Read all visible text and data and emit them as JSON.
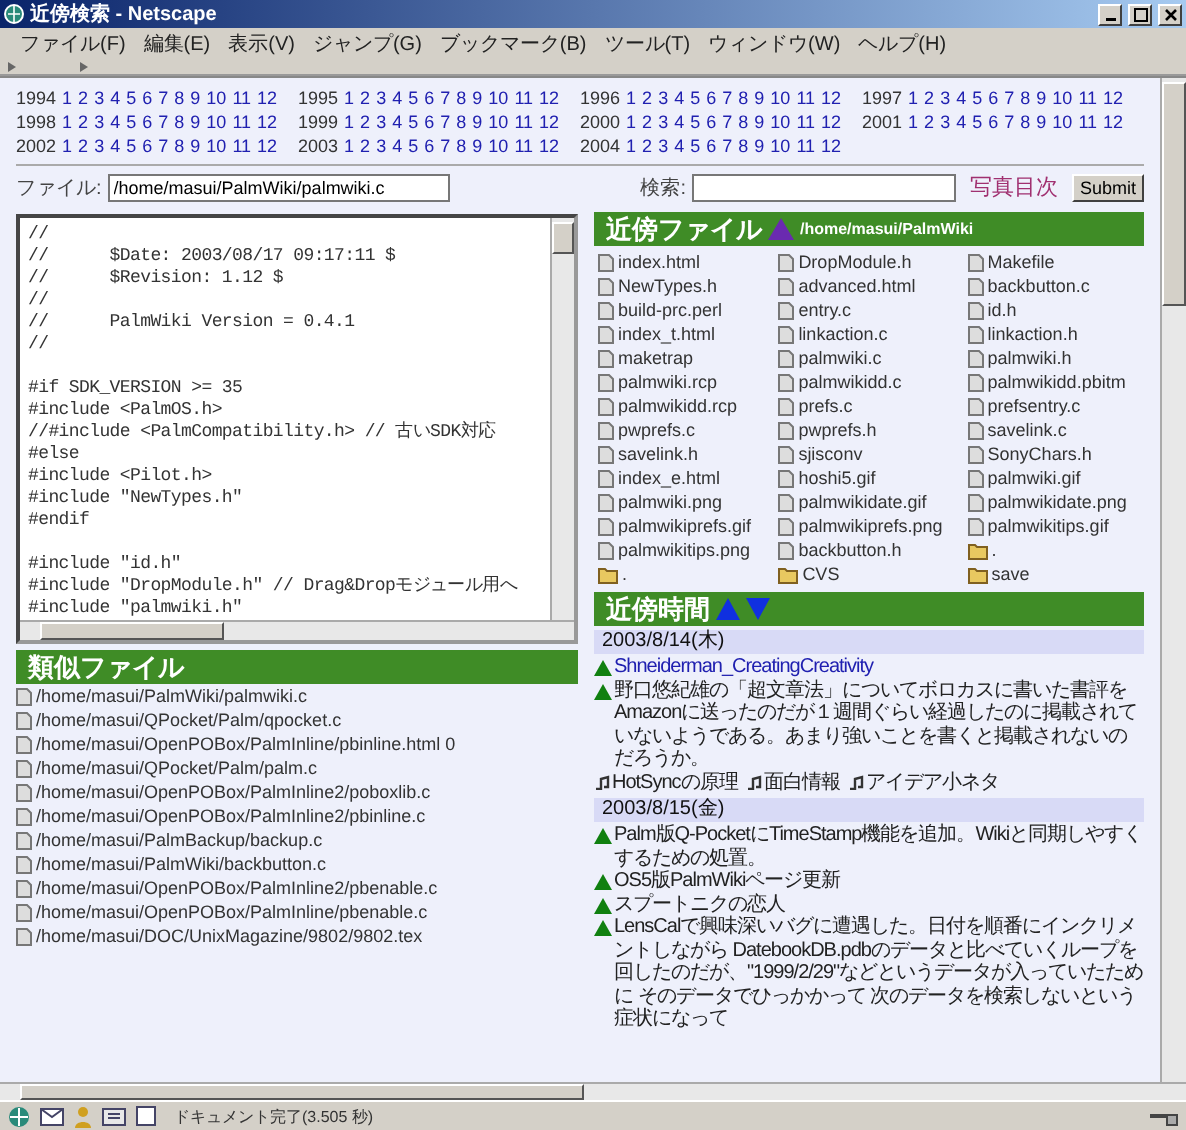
{
  "window": {
    "title": "近傍検索 - Netscape"
  },
  "menu": [
    "ファイル(F)",
    "編集(E)",
    "表示(V)",
    "ジャンプ(G)",
    "ブックマーク(B)",
    "ツール(T)",
    "ウィンドウ(W)",
    "ヘルプ(H)"
  ],
  "years": [
    {
      "year": "1994",
      "months": [
        "1",
        "2",
        "3",
        "4",
        "5",
        "6",
        "7",
        "8",
        "9",
        "10",
        "11",
        "12"
      ]
    },
    {
      "year": "1995",
      "months": [
        "1",
        "2",
        "3",
        "4",
        "5",
        "6",
        "7",
        "8",
        "9",
        "10",
        "11",
        "12"
      ]
    },
    {
      "year": "1996",
      "months": [
        "1",
        "2",
        "3",
        "4",
        "5",
        "6",
        "7",
        "8",
        "9",
        "10",
        "11",
        "12"
      ]
    },
    {
      "year": "1997",
      "months": [
        "1",
        "2",
        "3",
        "4",
        "5",
        "6",
        "7",
        "8",
        "9",
        "10",
        "11",
        "12"
      ]
    },
    {
      "year": "1998",
      "months": [
        "1",
        "2",
        "3",
        "4",
        "5",
        "6",
        "7",
        "8",
        "9",
        "10",
        "11",
        "12"
      ]
    },
    {
      "year": "1999",
      "months": [
        "1",
        "2",
        "3",
        "4",
        "5",
        "6",
        "7",
        "8",
        "9",
        "10",
        "11",
        "12"
      ]
    },
    {
      "year": "2000",
      "months": [
        "1",
        "2",
        "3",
        "4",
        "5",
        "6",
        "7",
        "8",
        "9",
        "10",
        "11",
        "12"
      ]
    },
    {
      "year": "2001",
      "months": [
        "1",
        "2",
        "3",
        "4",
        "5",
        "6",
        "7",
        "8",
        "9",
        "10",
        "11",
        "12"
      ]
    },
    {
      "year": "2002",
      "months": [
        "1",
        "2",
        "3",
        "4",
        "5",
        "6",
        "7",
        "8",
        "9",
        "10",
        "11",
        "12"
      ]
    },
    {
      "year": "2003",
      "months": [
        "1",
        "2",
        "3",
        "4",
        "5",
        "6",
        "7",
        "8",
        "9",
        "10",
        "11",
        "12"
      ]
    },
    {
      "year": "2004",
      "months": [
        "1",
        "2",
        "3",
        "4",
        "5",
        "6",
        "7",
        "8",
        "9",
        "10",
        "11",
        "12"
      ]
    }
  ],
  "file_field": {
    "label": "ファイル:",
    "value": "/home/masui/PalmWiki/palmwiki.c"
  },
  "search": {
    "label": "検索:",
    "photo_link": "写真目次",
    "submit": "Submit"
  },
  "code_blocks": [
    [
      "//",
      "//      $Date: 2003/08/17 09:17:11 $",
      "//      $Revision: 1.12 $",
      "//",
      "//      PalmWiki Version = 0.4.1",
      "//"
    ],
    [
      "#if SDK_VERSION >= 35",
      "#include <PalmOS.h>",
      "//#include <PalmCompatibility.h> // 古いSDK対応",
      "#else",
      "#include <Pilot.h>",
      "#include \"NewTypes.h\"",
      "#endif"
    ],
    [
      "#include \"id.h\"",
      "#include \"DropModule.h\" // Drag&Dropモジュール用へ",
      "#include \"palmwiki.h\""
    ]
  ],
  "similar": {
    "title": "類似ファイル",
    "paths": [
      "/home/masui/PalmWiki/palmwiki.c",
      "/home/masui/QPocket/Palm/qpocket.c",
      "/home/masui/OpenPOBox/PalmInline/pbinline.html 0",
      "/home/masui/QPocket/Palm/palm.c",
      "/home/masui/OpenPOBox/PalmInline2/poboxlib.c",
      "/home/masui/OpenPOBox/PalmInline2/pbinline.c",
      "/home/masui/PalmBackup/backup.c",
      "/home/masui/PalmWiki/backbutton.c",
      "/home/masui/OpenPOBox/PalmInline2/pbenable.c",
      "/home/masui/OpenPOBox/PalmInline/pbenable.c",
      "/home/masui/DOC/UnixMagazine/9802/9802.tex"
    ]
  },
  "nearby_files": {
    "title": "近傍ファイル",
    "path": "/home/masui/PalmWiki",
    "files": [
      {
        "name": "index.html",
        "kind": "file"
      },
      {
        "name": "DropModule.h",
        "kind": "file"
      },
      {
        "name": "Makefile",
        "kind": "file"
      },
      {
        "name": "NewTypes.h",
        "kind": "file"
      },
      {
        "name": "advanced.html",
        "kind": "file"
      },
      {
        "name": "backbutton.c",
        "kind": "file"
      },
      {
        "name": "build-prc.perl",
        "kind": "file"
      },
      {
        "name": "entry.c",
        "kind": "file"
      },
      {
        "name": "id.h",
        "kind": "file"
      },
      {
        "name": "index_t.html",
        "kind": "file"
      },
      {
        "name": "linkaction.c",
        "kind": "file"
      },
      {
        "name": "linkaction.h",
        "kind": "file"
      },
      {
        "name": "maketrap",
        "kind": "file"
      },
      {
        "name": "palmwiki.c",
        "kind": "file"
      },
      {
        "name": "palmwiki.h",
        "kind": "file"
      },
      {
        "name": "palmwiki.rcp",
        "kind": "file"
      },
      {
        "name": "palmwikidd.c",
        "kind": "file"
      },
      {
        "name": "palmwikidd.pbitm",
        "kind": "file"
      },
      {
        "name": "palmwikidd.rcp",
        "kind": "file"
      },
      {
        "name": "prefs.c",
        "kind": "file"
      },
      {
        "name": "prefsentry.c",
        "kind": "file"
      },
      {
        "name": "pwprefs.c",
        "kind": "file"
      },
      {
        "name": "pwprefs.h",
        "kind": "file"
      },
      {
        "name": "savelink.c",
        "kind": "file"
      },
      {
        "name": "savelink.h",
        "kind": "file"
      },
      {
        "name": "sjisconv",
        "kind": "file"
      },
      {
        "name": "SonyChars.h",
        "kind": "file"
      },
      {
        "name": "index_e.html",
        "kind": "file"
      },
      {
        "name": "hoshi5.gif",
        "kind": "file"
      },
      {
        "name": "palmwiki.gif",
        "kind": "file"
      },
      {
        "name": "palmwiki.png",
        "kind": "file"
      },
      {
        "name": "palmwikidate.gif",
        "kind": "file"
      },
      {
        "name": "palmwikidate.png",
        "kind": "file"
      },
      {
        "name": "palmwikiprefs.gif",
        "kind": "file"
      },
      {
        "name": "palmwikiprefs.png",
        "kind": "file"
      },
      {
        "name": "palmwikitips.gif",
        "kind": "file"
      },
      {
        "name": "palmwikitips.png",
        "kind": "file"
      },
      {
        "name": "backbutton.h",
        "kind": "file"
      },
      {
        "name": ".",
        "kind": "folder"
      },
      {
        "name": ".",
        "kind": "folder"
      },
      {
        "name": "CVS",
        "kind": "folder"
      },
      {
        "name": "save",
        "kind": "folder"
      }
    ]
  },
  "nearby_time": {
    "title": "近傍時間",
    "days": [
      {
        "date": "2003/8/14(木)",
        "entries": [
          {
            "kind": "link",
            "text": "Shneiderman_CreatingCreativity"
          },
          {
            "kind": "text",
            "text": "野口悠紀雄の「超文章法」についてボロカスに書いた書評をAmazonに送ったのだが１週間ぐらい経過したのに掲載されていないようである。あまり強いことを書くと掲載されないのだろうか。"
          }
        ],
        "tags": [
          "HotSyncの原理",
          "面白情報",
          "アイデア小ネタ"
        ]
      },
      {
        "date": "2003/8/15(金)",
        "entries": [
          {
            "kind": "text",
            "text": "Palm版Q-PocketにTimeStamp機能を追加。Wikiと同期しやすくするための処置。"
          },
          {
            "kind": "text",
            "text": "OS5版PalmWikiページ更新"
          },
          {
            "kind": "text",
            "text": "スプートニクの恋人"
          },
          {
            "kind": "text",
            "text": "LensCalで興味深いバグに遭遇した。日付を順番にインクリメントしながら DatebookDB.pdbのデータと比べていくループを回したのだが、\"1999/2/29\"などというデータが入っていたために そのデータでひっかかって 次のデータを検索しないという症状になって"
          }
        ]
      }
    ]
  },
  "status": "ドキュメント完了(3.505 秒)"
}
